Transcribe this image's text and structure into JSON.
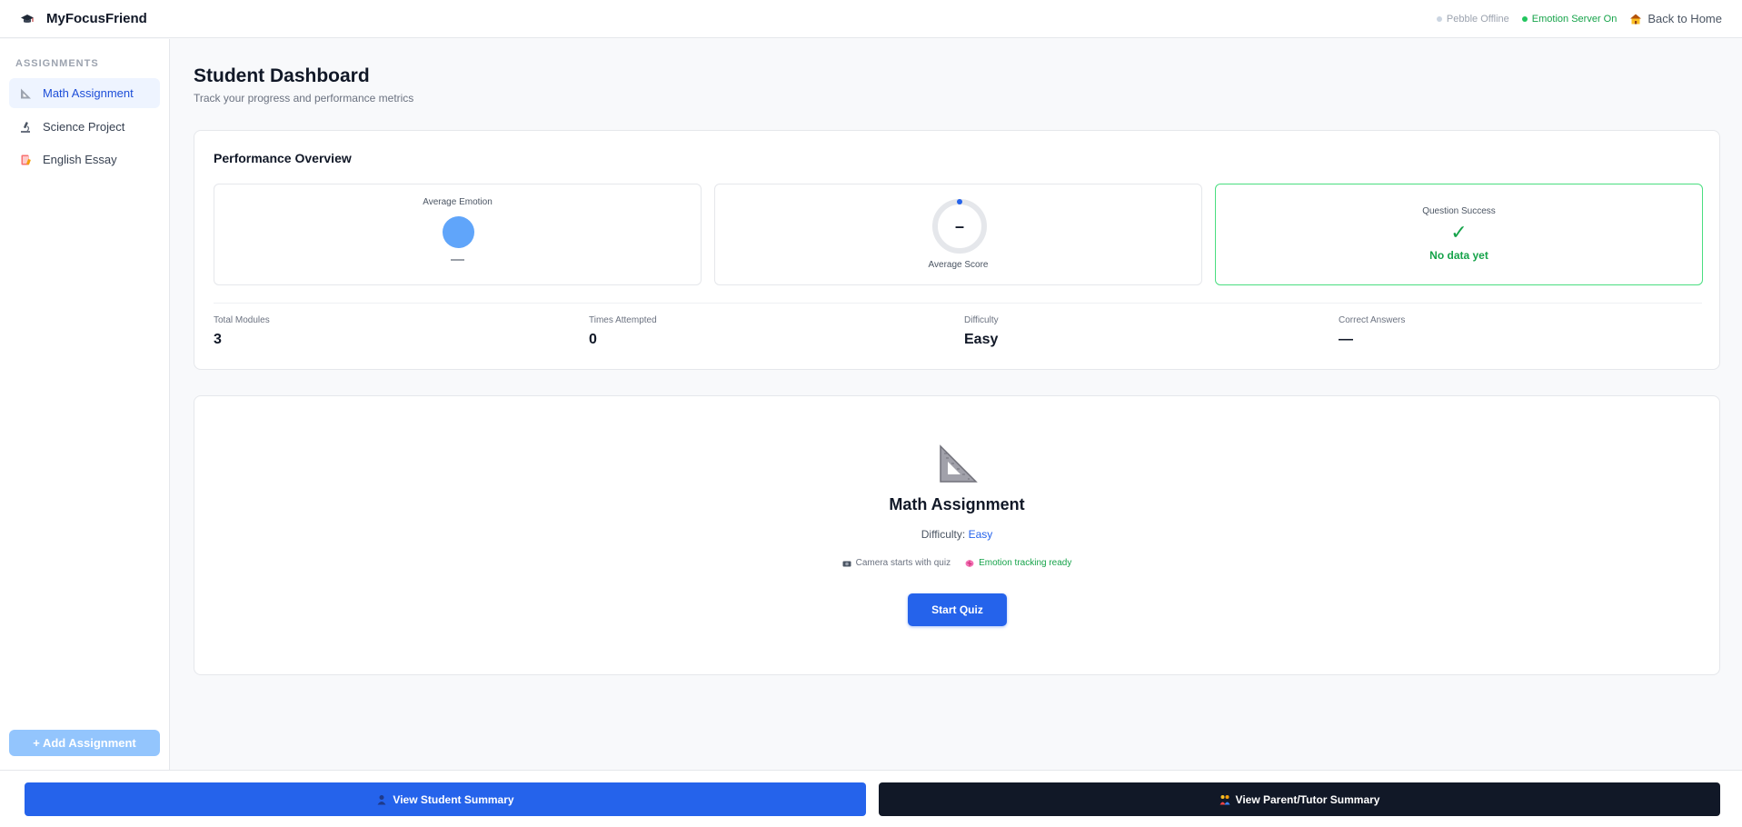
{
  "app": {
    "name": "MyFocusFriend",
    "icon": "graduation-cap-icon"
  },
  "header": {
    "pebble_status": "Pebble Offline",
    "emotion_status": "Emotion Server On",
    "home_link": "Back to Home",
    "colors": {
      "offline": "#cbd5e1",
      "online": "#22c55e"
    }
  },
  "sidebar": {
    "heading": "ASSIGNMENTS",
    "items": [
      {
        "label": "Math Assignment",
        "icon": "triangle-ruler-icon",
        "active": true
      },
      {
        "label": "Science Project",
        "icon": "microscope-icon",
        "active": false
      },
      {
        "label": "English Essay",
        "icon": "book-icon",
        "active": false
      }
    ],
    "add_button": "+ Add Assignment"
  },
  "main": {
    "title": "Student Dashboard",
    "subtitle": "Track your progress and performance metrics"
  },
  "performance": {
    "title": "Performance Overview",
    "average_emotion": {
      "label": "Average Emotion",
      "value": "—"
    },
    "average_score": {
      "label": "Average Score",
      "value": "–",
      "progress": 0
    },
    "question_success": {
      "label": "Question Success",
      "check": "✓",
      "message": "No data yet"
    },
    "stats": [
      {
        "label": "Total Modules",
        "value": "3"
      },
      {
        "label": "Times Attempted",
        "value": "0"
      },
      {
        "label": "Difficulty",
        "value": "Easy"
      },
      {
        "label": "Correct Answers",
        "value": "—"
      }
    ]
  },
  "quiz": {
    "title": "Math Assignment",
    "difficulty_label": "Difficulty:",
    "difficulty_value": "Easy",
    "camera_note": "Camera starts with quiz",
    "emotion_note": "Emotion tracking ready",
    "start_button": "Start Quiz"
  },
  "footer": {
    "student_button": "View Student Summary",
    "parent_button": "View Parent/Tutor Summary"
  },
  "colors": {
    "accent": "#2563eb",
    "success": "#16a34a",
    "dark": "#111827"
  }
}
